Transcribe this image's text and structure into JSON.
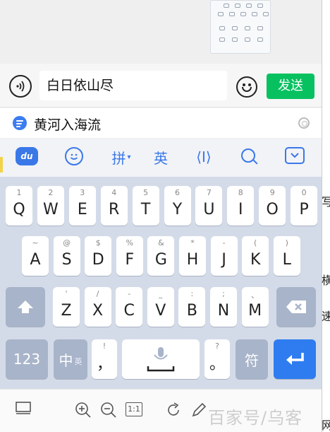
{
  "chat": {
    "input_value": "白日依山尽",
    "send_label": "发送"
  },
  "suggestion": {
    "text": "黄河入海流"
  },
  "toolbar": {
    "du_label": "du",
    "pinyin_label": "拼",
    "pinyin_caret": "▾",
    "english_label": "英",
    "cursor_label": "⟨I⟩"
  },
  "keyboard": {
    "row1": [
      {
        "sub": "1",
        "main": "Q"
      },
      {
        "sub": "2",
        "main": "W"
      },
      {
        "sub": "3",
        "main": "E"
      },
      {
        "sub": "4",
        "main": "R"
      },
      {
        "sub": "5",
        "main": "T"
      },
      {
        "sub": "6",
        "main": "Y"
      },
      {
        "sub": "7",
        "main": "U"
      },
      {
        "sub": "8",
        "main": "I"
      },
      {
        "sub": "9",
        "main": "O"
      },
      {
        "sub": "0",
        "main": "P"
      }
    ],
    "row2": [
      {
        "sub": "~",
        "main": "A"
      },
      {
        "sub": "@",
        "main": "S"
      },
      {
        "sub": "$",
        "main": "D"
      },
      {
        "sub": "%",
        "main": "F"
      },
      {
        "sub": "&",
        "main": "G"
      },
      {
        "sub": "*",
        "main": "H"
      },
      {
        "sub": "-",
        "main": "J"
      },
      {
        "sub": "(",
        "main": "K"
      },
      {
        "sub": ")",
        "main": "L"
      }
    ],
    "row3": [
      {
        "sub": "'",
        "main": "Z"
      },
      {
        "sub": "/",
        "main": "X"
      },
      {
        "sub": "-",
        "main": "C"
      },
      {
        "sub": "_",
        "main": "V"
      },
      {
        "sub": ":",
        "main": "B"
      },
      {
        "sub": ";",
        "main": "N"
      },
      {
        "sub": "、",
        "main": "M"
      }
    ],
    "num_label": "123",
    "zh_label": "中",
    "en_small_label": "英",
    "comma_sub": "!",
    "comma_main": "，",
    "period_sub": "?",
    "period_main": "。",
    "symbol_label": "符"
  },
  "bottom": {
    "one_to_one_label": "1:1"
  },
  "watermark": {
    "text": "百家号/乌客"
  },
  "background": {
    "chars": [
      "写",
      "横",
      "速",
      "网"
    ]
  },
  "colors": {
    "send_green": "#07c160",
    "accent_blue": "#3a78e8",
    "keyboard_bg": "#d4dbe8",
    "dark_key": "#a8b4c9",
    "enter_blue": "#2f7cf0"
  }
}
